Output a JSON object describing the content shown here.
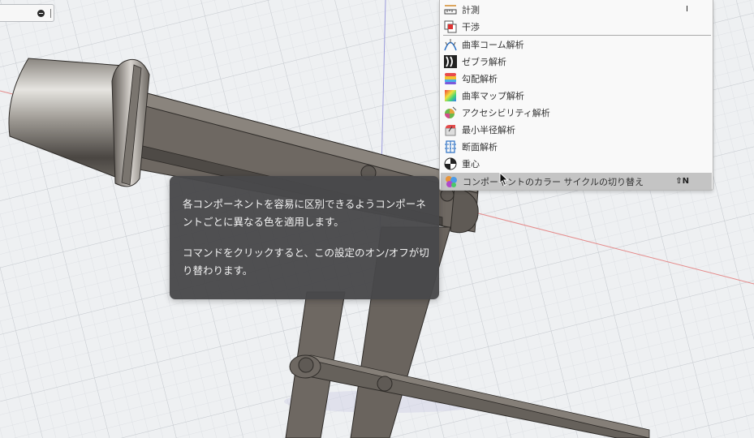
{
  "menu": {
    "items": [
      {
        "label": "計測",
        "shortcut": "I",
        "icon": "measure-icon"
      },
      {
        "label": "干渉",
        "shortcut": "",
        "icon": "interference-icon"
      },
      {
        "label": "曲率コーム解析",
        "shortcut": "",
        "icon": "curvature-comb-icon"
      },
      {
        "label": "ゼブラ解析",
        "shortcut": "",
        "icon": "zebra-icon"
      },
      {
        "label": "勾配解析",
        "shortcut": "",
        "icon": "draft-analysis-icon"
      },
      {
        "label": "曲率マップ解析",
        "shortcut": "",
        "icon": "curvature-map-icon"
      },
      {
        "label": "アクセシビリティ解析",
        "shortcut": "",
        "icon": "accessibility-icon"
      },
      {
        "label": "最小半径解析",
        "shortcut": "",
        "icon": "minimum-radius-icon"
      },
      {
        "label": "断面解析",
        "shortcut": "",
        "icon": "section-analysis-icon"
      },
      {
        "label": "重心",
        "shortcut": "",
        "icon": "center-of-mass-icon"
      },
      {
        "label": "コンポーネントのカラー サイクルの切り替え",
        "shortcut": "⇧N",
        "icon": "component-color-cycle-icon"
      }
    ]
  },
  "tooltip": {
    "paragraph1": "各コンポーネントを容易に区別できるようコンポーネントごとに異なる色を適用します。",
    "paragraph2": "コマンドをクリックすると、この設定のオン/オフが切り替わります。"
  },
  "colors": {
    "grid_background": "#eef0f2",
    "grid_line": "#d3d6da",
    "axis_red": "#e58a8a",
    "axis_blue": "#8f8fd8",
    "model_metal": "#6e6862",
    "tooltip_bg": "#48484a",
    "menu_highlight": "#c4c4c4"
  }
}
